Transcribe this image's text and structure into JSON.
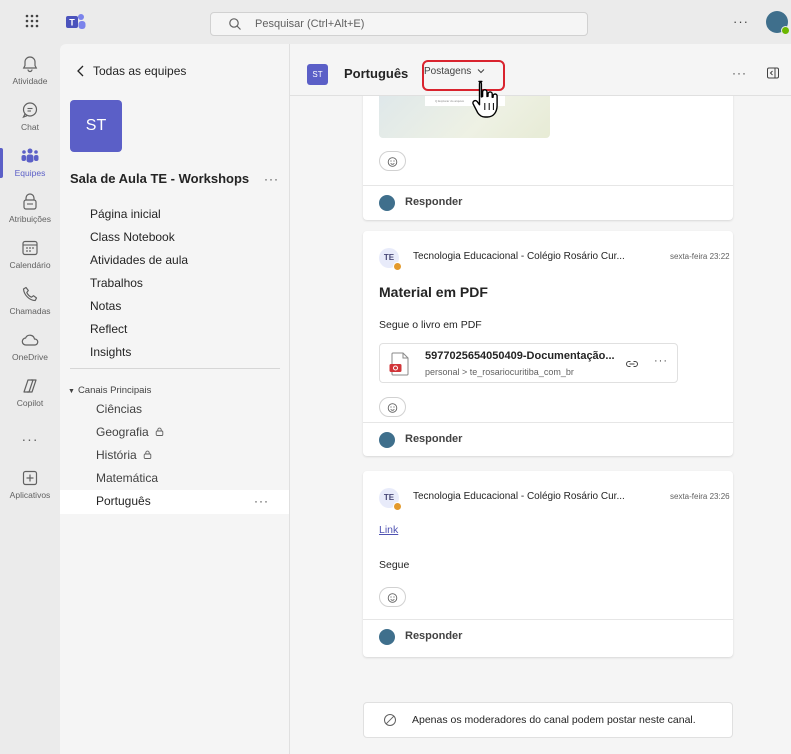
{
  "search": {
    "placeholder": "Pesquisar (Ctrl+Alt+E)"
  },
  "titlebar": {
    "more": "···"
  },
  "rail": [
    {
      "label": "Atividade",
      "icon": "bell-icon"
    },
    {
      "label": "Chat",
      "icon": "chat-icon"
    },
    {
      "label": "Equipes",
      "icon": "teams-icon",
      "active": true
    },
    {
      "label": "Atribuições",
      "icon": "assignments-icon"
    },
    {
      "label": "Calendário",
      "icon": "calendar-icon"
    },
    {
      "label": "Chamadas",
      "icon": "phone-icon"
    },
    {
      "label": "OneDrive",
      "icon": "cloud-icon"
    },
    {
      "label": "Copilot",
      "icon": "copilot-icon"
    },
    {
      "label": "Aplicativos",
      "icon": "add-apps-icon"
    }
  ],
  "rail_more": "···",
  "panel": {
    "back_label": "Todas as equipes",
    "team_initials": "ST",
    "team_name": "Sala de Aula TE - Workshops",
    "team_more": "···",
    "nav": [
      "Página inicial",
      "Class Notebook",
      "Atividades de aula",
      "Trabalhos",
      "Notas",
      "Reflect",
      "Insights"
    ],
    "section_title": "Canais Principais",
    "channels": [
      {
        "name": "Ciências",
        "locked": false
      },
      {
        "name": "Geografia",
        "locked": true
      },
      {
        "name": "História",
        "locked": true
      },
      {
        "name": "Matemática",
        "locked": false
      },
      {
        "name": "Português",
        "locked": false,
        "selected": true
      }
    ],
    "channel_more": "···"
  },
  "header": {
    "avatar": "ST",
    "channel": "Português",
    "tab": "Postagens",
    "more": "···"
  },
  "posts": {
    "p0": {
      "reply": "Responder",
      "thumb_text": "Q  Explorar do arquivo"
    },
    "p1": {
      "avatar": "TE",
      "author": "Tecnologia Educacional - Colégio Rosário Cur...",
      "time": "sexta-feira 23:22",
      "subject": "Material em PDF",
      "body": "Segue o livro em PDF",
      "file_name": "5977025654050409-Documentação...",
      "file_path": "personal > te_rosariocuritiba_com_br",
      "file_more": "···",
      "reply": "Responder"
    },
    "p2": {
      "avatar": "TE",
      "author": "Tecnologia Educacional - Colégio Rosário Cur...",
      "time": "sexta-feira 23:26",
      "link": "Link",
      "body": "Segue",
      "reply": "Responder"
    }
  },
  "notice": "Apenas os moderadores do canal podem postar neste canal.",
  "colors": {
    "brand": "#5b5fc7",
    "highlight": "#d9232e",
    "link": "#4f52b2"
  }
}
